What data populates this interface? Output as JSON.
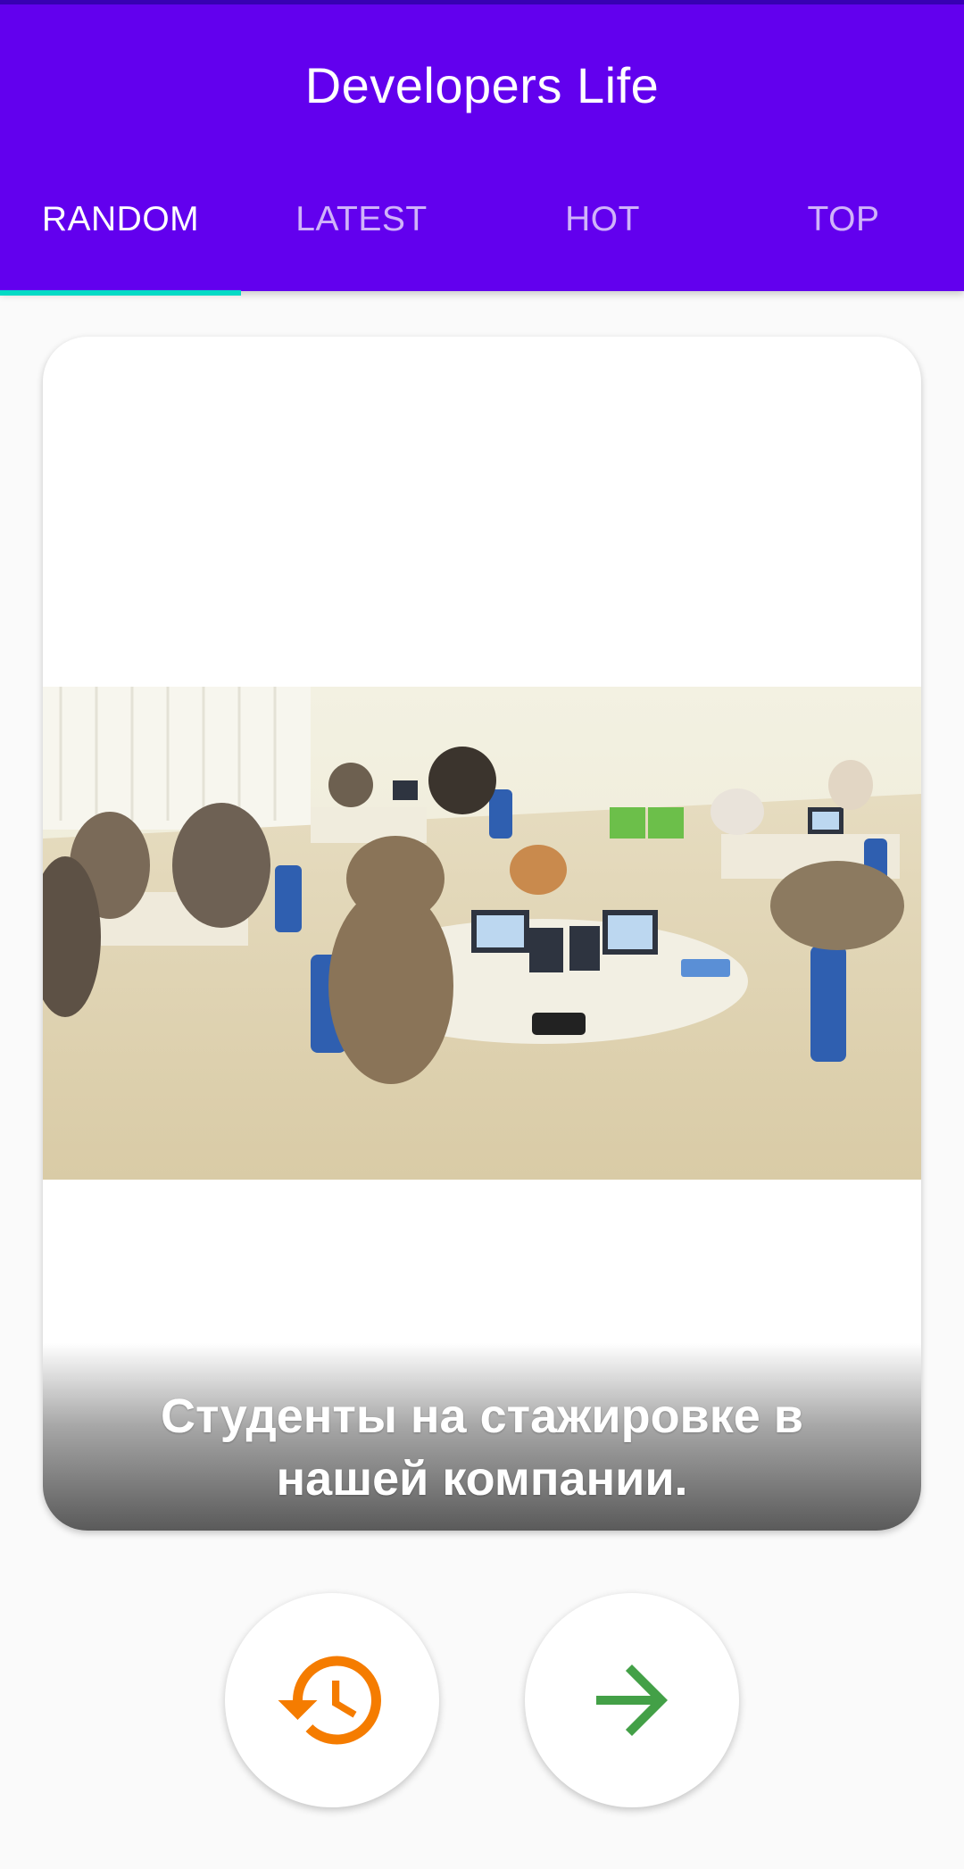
{
  "app": {
    "title": "Developers Life"
  },
  "tabs": [
    {
      "label": "RANDOM",
      "active": true
    },
    {
      "label": "LATEST",
      "active": false
    },
    {
      "label": "HOT",
      "active": false
    },
    {
      "label": "TOP",
      "active": false
    }
  ],
  "post": {
    "caption": "Студенты на стажировке в нашей компании.",
    "image_icon": "cats-in-office-gif"
  },
  "actions": {
    "back_icon": "history-icon",
    "next_icon": "arrow-forward-icon"
  },
  "colors": {
    "primary": "#6200ee",
    "primary_dark": "#3700b3",
    "accent": "#03dac5",
    "back_icon": "#f57c00",
    "next_icon": "#43a047"
  }
}
